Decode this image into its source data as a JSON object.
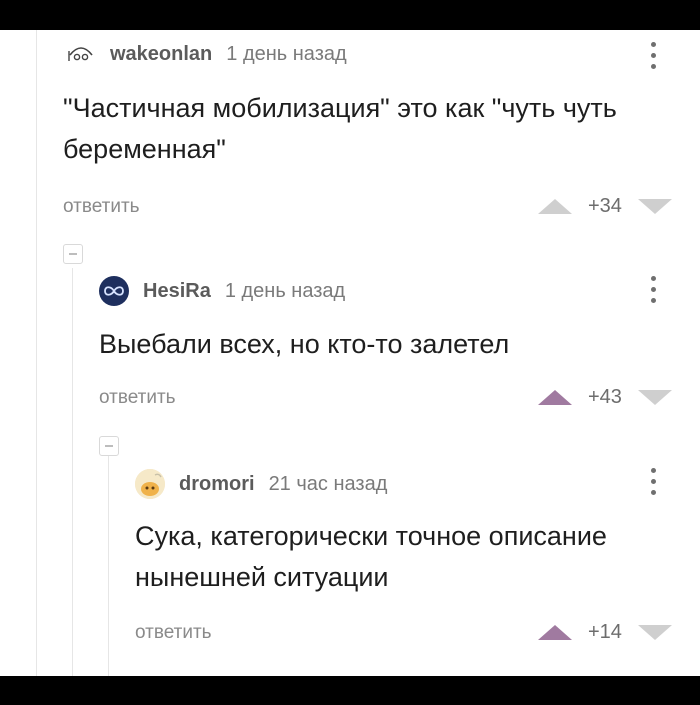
{
  "comments": [
    {
      "author": "wakeonlan",
      "date": "1 день назад",
      "text": "\"Частичная мобилизация\" это как \"чуть чуть беременная\"",
      "reply": "ответить",
      "score": "+34",
      "avatar_icon": "sleepy-face-icon"
    },
    {
      "author": "HesiRa",
      "date": "1 день назад",
      "text": "Выебали всех, но кто-то залетел",
      "reply": "ответить",
      "score": "+43",
      "avatar_icon": "infinity-icon"
    },
    {
      "author": "dromori",
      "date": "21 час назад",
      "text": "Сука, категорически точное описание нынешней ситуации",
      "reply": "ответить",
      "score": "+14",
      "avatar_icon": "cartoon-character-icon"
    }
  ],
  "colors": {
    "upvote_active": "#a07aa0",
    "vote_inactive": "#cfcfcf",
    "reply_text": "#8a8a8a"
  }
}
